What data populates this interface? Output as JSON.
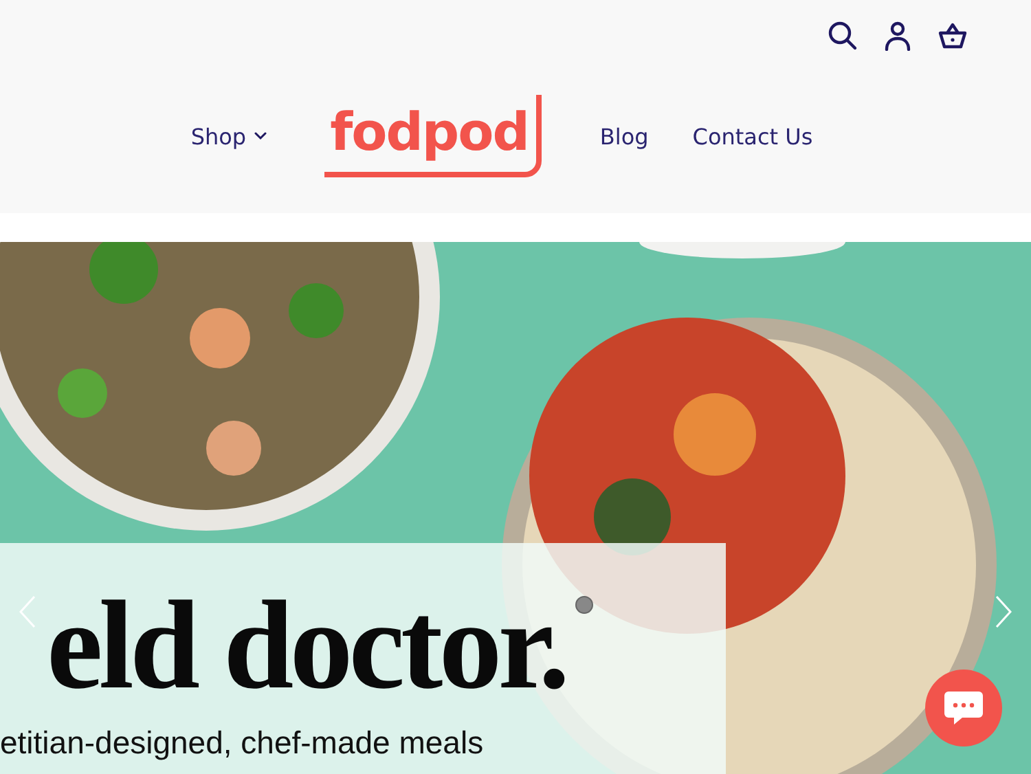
{
  "header": {
    "logo": "fodpod",
    "nav": [
      {
        "label": "Shop",
        "has_menu": true
      },
      {
        "label": "Blog",
        "has_menu": false
      },
      {
        "label": "Contact Us",
        "has_menu": false
      }
    ]
  },
  "hero": {
    "heading": "eld doctor.",
    "subheading": "etitian-designed, chef-made meals"
  }
}
